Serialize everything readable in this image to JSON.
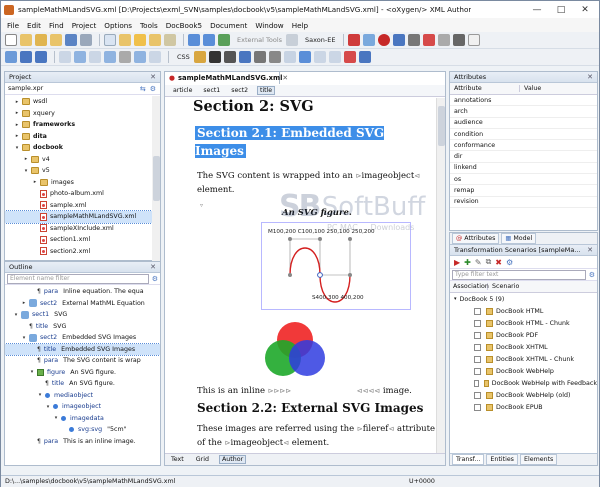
{
  "window": {
    "title": "sampleMathMLandSVG.xml [D:\\Projects\\exml_SVN\\samples\\docbook\\v5\\sampleMathMLandSVG.xml] - <oXygen/> XML Author",
    "minimize": "—",
    "maximize": "□",
    "close": "✕"
  },
  "menu": [
    "File",
    "Edit",
    "Find",
    "Project",
    "Options",
    "Tools",
    "DocBook5",
    "Document",
    "Window",
    "Help"
  ],
  "toolbar": {
    "external_tools": "External Tools",
    "saxon": "Saxon-EE",
    "css": "CSS"
  },
  "project": {
    "title": "Project",
    "file": "sample.xpr",
    "items": [
      {
        "label": "wsdl",
        "indent": 1,
        "type": "folder",
        "twisty": "▸"
      },
      {
        "label": "xquery",
        "indent": 1,
        "type": "folder",
        "twisty": "▸"
      },
      {
        "label": "frameworks",
        "indent": 1,
        "type": "folder",
        "twisty": "▸",
        "bold": true
      },
      {
        "label": "dita",
        "indent": 1,
        "type": "folder",
        "twisty": "▸",
        "bold": true
      },
      {
        "label": "docbook",
        "indent": 1,
        "type": "folder",
        "twisty": "▾",
        "bold": true
      },
      {
        "label": "v4",
        "indent": 2,
        "type": "folder",
        "twisty": "▸"
      },
      {
        "label": "v5",
        "indent": 2,
        "type": "folder",
        "twisty": "▾"
      },
      {
        "label": "images",
        "indent": 3,
        "type": "folder",
        "twisty": "▸"
      },
      {
        "label": "photo-album.xml",
        "indent": 3,
        "type": "xml"
      },
      {
        "label": "sample.xml",
        "indent": 3,
        "type": "xml"
      },
      {
        "label": "sampleMathMLandSVG.xml",
        "indent": 3,
        "type": "xml",
        "selected": true
      },
      {
        "label": "sampleXInclude.xml",
        "indent": 3,
        "type": "xml"
      },
      {
        "label": "section1.xml",
        "indent": 3,
        "type": "xml"
      },
      {
        "label": "section2.xml",
        "indent": 3,
        "type": "xml"
      }
    ]
  },
  "outline": {
    "title": "Outline",
    "filter_placeholder": "Element name filter",
    "items": [
      {
        "indent": 3,
        "kind": "pi",
        "tag": "para",
        "text": "Inline equation. The equa"
      },
      {
        "indent": 2,
        "kind": "sect",
        "tag": "sect2",
        "text": "External MathML Equation",
        "twisty": "▸"
      },
      {
        "indent": 1,
        "kind": "sect",
        "tag": "sect1",
        "text": "SVG",
        "twisty": "▾"
      },
      {
        "indent": 2,
        "kind": "pi",
        "tag": "title",
        "text": "SVG"
      },
      {
        "indent": 2,
        "kind": "sect",
        "tag": "sect2",
        "text": "Embedded SVG Images",
        "twisty": "▾"
      },
      {
        "indent": 3,
        "kind": "pi",
        "tag": "title",
        "text": "Embedded SVG Images",
        "selected": true
      },
      {
        "indent": 3,
        "kind": "pi",
        "tag": "para",
        "text": "The SVG content is wrap"
      },
      {
        "indent": 3,
        "kind": "fig",
        "tag": "figure",
        "text": "An SVG figure.",
        "twisty": "▾"
      },
      {
        "indent": 4,
        "kind": "pi",
        "tag": "title",
        "text": "An SVG figure."
      },
      {
        "indent": 4,
        "kind": "dot",
        "tag": "mediaobject",
        "text": "",
        "twisty": "▾"
      },
      {
        "indent": 5,
        "kind": "dot",
        "tag": "imageobject",
        "text": "",
        "twisty": "▾"
      },
      {
        "indent": 6,
        "kind": "dot",
        "tag": "imagedata",
        "text": "",
        "twisty": "▾"
      },
      {
        "indent": 7,
        "kind": "dot",
        "tag": "svg:svg",
        "text": "\"5cm\""
      },
      {
        "indent": 3,
        "kind": "pi",
        "tag": "para",
        "text": "This is an inline image."
      }
    ]
  },
  "editor": {
    "tab": "sampleMathMLandSVG.xml",
    "breadcrumb": [
      "article",
      "sect1",
      "sect2",
      "title"
    ],
    "section2": "Section 2: SVG",
    "section21": "Section 2.1: Embedded SVG Images",
    "para1_a": "The SVG content is wrapped into an",
    "para1_tag": "imageobject",
    "para1_b": "element.",
    "figure_title": "An SVG figure.",
    "path_label1": "M100,200 C100,100 250,100 250,200",
    "path_label2": "S400,300 400,200",
    "inline_a": "This is an inline",
    "inline_b": "image.",
    "section22": "Section 2.2: External SVG Images",
    "para3_a": "These images are referred using the",
    "para3_tag": "fileref",
    "para3_b": "attribute",
    "para4_a": "of the",
    "para4_tag": "imageobject",
    "para4_b": "element.",
    "modes": [
      "Text",
      "Grid",
      "Author"
    ],
    "active_mode": "Author"
  },
  "attributes": {
    "title": "Attributes",
    "col_attr": "Attribute",
    "col_val": "Value",
    "rows": [
      "annotations",
      "arch",
      "audience",
      "condition",
      "conformance",
      "dir",
      "linkend",
      "os",
      "remap",
      "revision"
    ]
  },
  "transform": {
    "tabs": [
      "Attributes",
      "Model"
    ],
    "title": "Transformation Scenarios [sampleMa...",
    "filter_placeholder": "Type filter text",
    "col_assoc": "Association",
    "col_scen": "Scenario",
    "group": "DocBook 5 (9)",
    "scenarios": [
      "DocBook HTML",
      "DocBook HTML - Chunk",
      "DocBook PDF",
      "DocBook XHTML",
      "DocBook XHTML - Chunk",
      "DocBook WebHelp",
      "DocBook WebHelp with Feedback",
      "DocBook WebHelp (old)",
      "DocBook EPUB"
    ],
    "bottom_tabs": [
      "Transf...",
      "Entities",
      "Elements"
    ]
  },
  "watermark": {
    "brand": "SoftBuff",
    "sub": "PC MAC ... Downloads"
  },
  "status": {
    "path": "D:\\...\\samples\\docbook\\v5\\sampleMathMLandSVG.xml",
    "pos": "U+0000"
  }
}
